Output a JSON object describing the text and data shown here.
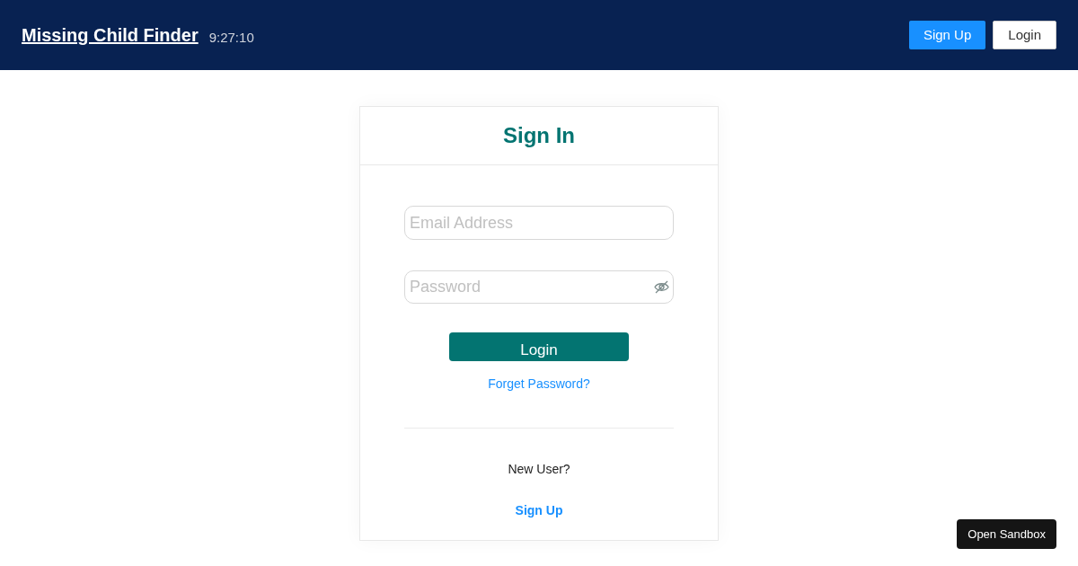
{
  "header": {
    "title": "Missing Child Finder",
    "time": "9:27:10",
    "buttons": [
      {
        "label": "Sign Up",
        "kind": "primary"
      },
      {
        "label": "Login",
        "kind": "outline"
      }
    ]
  },
  "card": {
    "title": "Sign In",
    "email": {
      "placeholder": "Email Address"
    },
    "password": {
      "placeholder": "Password"
    },
    "login_button": "Login",
    "forgot_link": "Forget Password?",
    "new_user": "New User?",
    "signup_link": "Sign Up"
  },
  "sandbox_button": "Open Sandbox"
}
